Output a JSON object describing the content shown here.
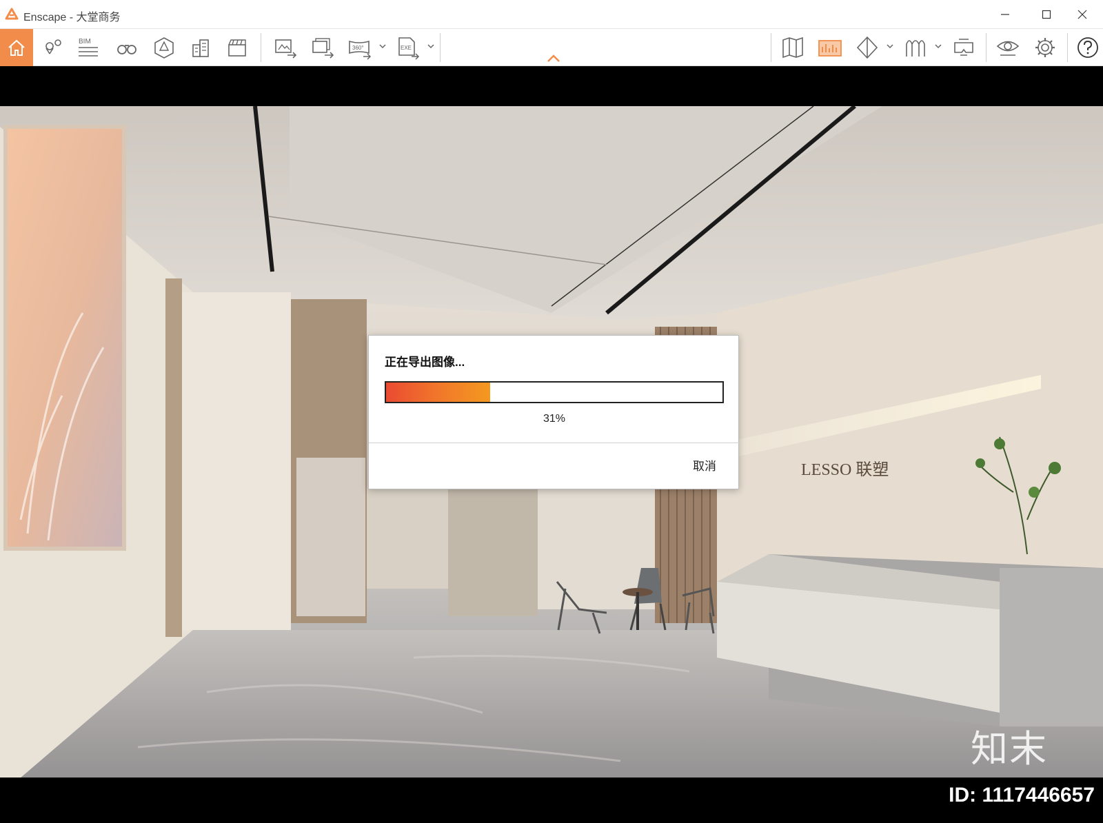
{
  "window": {
    "title": "Enscape - 大堂商务",
    "accent": "#f28c4a"
  },
  "toolbar": {
    "home_icon": "home-icon",
    "bim_label": "BIM",
    "video360_label": "360°",
    "exe_label": "EXE"
  },
  "dialog": {
    "message": "正在导出图像...",
    "progress_percent": 31,
    "progress_text": "31%",
    "cancel_label": "取消"
  },
  "scene": {
    "brand_sign": "LESSO 联塑"
  },
  "watermark": {
    "corner_text": "知末",
    "id_text": "ID: 1117446657"
  }
}
